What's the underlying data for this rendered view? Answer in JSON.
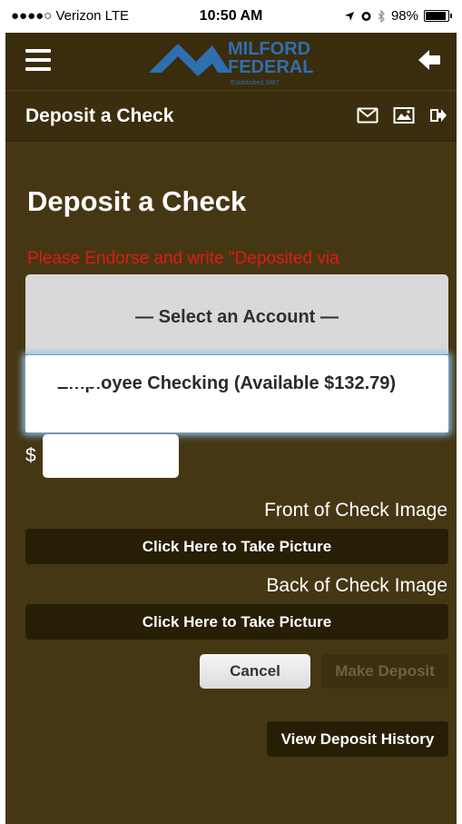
{
  "status_bar": {
    "carrier": "●●●●○ Verizon  LTE",
    "time": "10:50 AM",
    "battery": "98%",
    "battery_level": 0.98
  },
  "app_bar": {
    "logo_line1": "MILFORD",
    "logo_line2": "FEDERAL",
    "logo_tagline": "Established 1887",
    "menu_icon": "hamburger-menu-icon",
    "back_icon": "back-arrow-icon"
  },
  "page_bar": {
    "title": "Deposit a Check",
    "icons": [
      "mail-icon",
      "image-icon",
      "logout-icon"
    ]
  },
  "main": {
    "heading": "Deposit a Check",
    "warning": "Please Endorse and write \"Deposited via",
    "account_select": {
      "placeholder": "— Select an Account —",
      "option": "- Employee Checking (Available $132.79)"
    },
    "currency_symbol": "$",
    "amount_value": "",
    "front_label": "Front of Check Image",
    "front_button": "Click Here to Take Picture",
    "back_label": "Back of Check Image",
    "back_button": "Click Here to Take Picture",
    "cancel_button": "Cancel",
    "make_deposit_button": "Make Deposit",
    "history_button": "View Deposit History"
  },
  "colors": {
    "background": "#463714",
    "app_bar": "#3a2d0d",
    "button_dark": "#271e06",
    "warning": "#e01b10",
    "logo_blue": "#2f6fb0"
  }
}
